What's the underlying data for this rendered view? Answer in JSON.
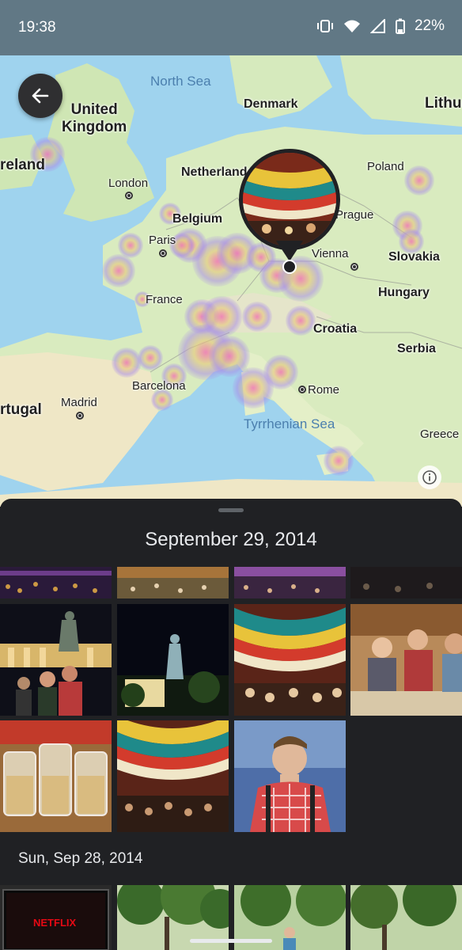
{
  "status_bar": {
    "time": "19:38",
    "battery": "22%"
  },
  "map": {
    "countries": {
      "uk": "United\nKingdom",
      "ireland": "reland",
      "denmark": "Denmark",
      "lithuania": "Lithua",
      "netherlands": "Netherlands",
      "belgium": "Belgium",
      "poland": "Poland",
      "france": "France",
      "slovakia": "Slovakia",
      "hungary": "Hungary",
      "croatia": "Croatia",
      "serbia": "Serbia",
      "portugal": "rtugal",
      "greece": "Greece"
    },
    "cities": {
      "london": "London",
      "paris": "Paris",
      "prague": "Prague",
      "vienna": "Vienna",
      "barcelona": "Barcelona",
      "madrid": "Madrid",
      "rome": "Rome"
    },
    "seas": {
      "north_sea": "North Sea",
      "tyrrhenian_sea": "Tyrrhenian Sea"
    }
  },
  "sheet": {
    "title": "September 29, 2014",
    "day_label": "Sun, Sep 28, 2014"
  },
  "photos_sep29": [
    "night crowd",
    "beer tent aerial",
    "festival crowd",
    "tent interior",
    "Bavaria statue with people",
    "Bavaria statue at night",
    "colorful tent ceiling",
    "friends at table",
    "beer mugs",
    "tent ceiling crowd",
    "man selfie"
  ],
  "photos_sep28": [
    "tv netflix",
    "park trees",
    "park trees people",
    "park trees green"
  ],
  "tv_text": "NETFLIX"
}
